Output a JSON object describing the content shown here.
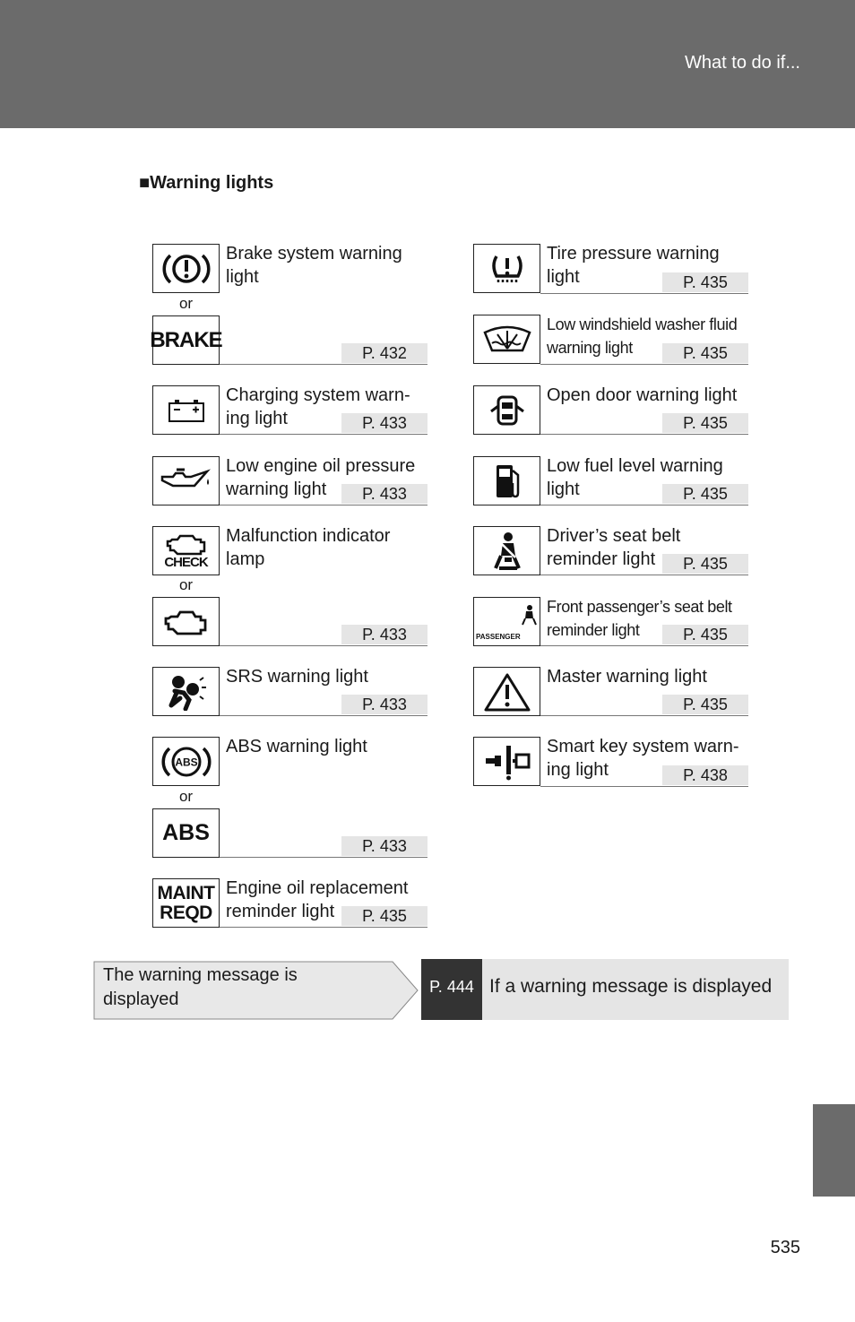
{
  "header": {
    "title": "What to do if..."
  },
  "section_title": "■Warning lights",
  "or_label": "or",
  "left": [
    {
      "label": "Brake system warning light",
      "page": "P. 432",
      "icons": [
        "brake-circle-icon",
        "brake-text-icon"
      ],
      "icon_text": [
        "",
        "BRAKE"
      ]
    },
    {
      "label": "Charging system warn-ing light",
      "page": "P. 433",
      "icons": [
        "battery-icon"
      ]
    },
    {
      "label": "Low engine oil pressure warning light",
      "page": "P. 433",
      "icons": [
        "oil-can-icon"
      ]
    },
    {
      "label": "Malfunction indicator lamp",
      "page": "P. 433",
      "icons": [
        "check-engine-icon",
        "engine-icon"
      ],
      "icon_text": [
        "CHECK",
        ""
      ]
    },
    {
      "label": "SRS warning light",
      "page": "P. 433",
      "icons": [
        "airbag-icon"
      ]
    },
    {
      "label": "ABS warning light",
      "page": "P. 433",
      "icons": [
        "abs-circle-icon",
        "abs-text-icon"
      ],
      "icon_text": [
        "ABS",
        "ABS"
      ]
    },
    {
      "label": "Engine oil replacement reminder light",
      "page": "P. 435",
      "icons": [
        "maint-reqd-icon"
      ],
      "icon_text": [
        "MAINT",
        "REQD"
      ]
    }
  ],
  "right": [
    {
      "label": "Tire pressure warning light",
      "page": "P. 435",
      "icons": [
        "tire-pressure-icon"
      ]
    },
    {
      "label": "Low windshield washer fluid warning light",
      "page": "P. 435",
      "icons": [
        "washer-fluid-icon"
      ]
    },
    {
      "label": "Open door warning light",
      "page": "P. 435",
      "icons": [
        "open-door-icon"
      ]
    },
    {
      "label": "Low fuel level warning light",
      "page": "P. 435",
      "icons": [
        "fuel-pump-icon"
      ]
    },
    {
      "label": "Driver’s seat belt reminder light",
      "page": "P. 435",
      "icons": [
        "seat-belt-icon"
      ]
    },
    {
      "label": "Front passenger’s seat belt reminder light",
      "page": "P. 435",
      "icons": [
        "passenger-seat-belt-icon"
      ],
      "icon_text": [
        "PASSENGER"
      ]
    },
    {
      "label": "Master warning light",
      "page": "P. 435",
      "icons": [
        "master-warning-icon"
      ]
    },
    {
      "label": "Smart key system warn-ing light",
      "page": "P. 438",
      "icons": [
        "smart-key-icon"
      ]
    }
  ],
  "message": {
    "condition": "The warning message is displayed",
    "page": "P. 444",
    "action": "If a warning message is displayed"
  },
  "page_number": "535"
}
